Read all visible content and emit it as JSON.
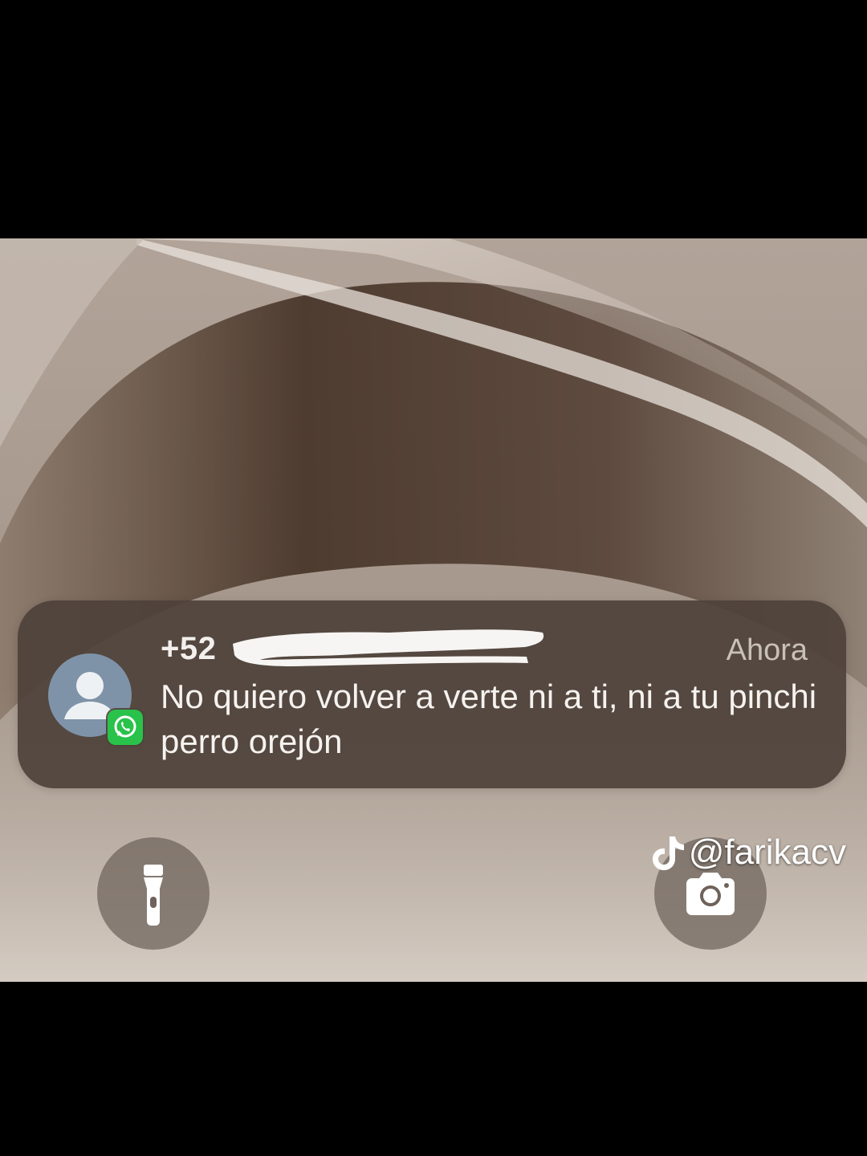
{
  "notification": {
    "sender": "+52",
    "time": "Ahora",
    "message": "No quiero volver a verte ni a ti, ni a tu pinchi perro orejón",
    "app_icon": "whatsapp-icon",
    "avatar_icon": "default-person-icon"
  },
  "lockscreen": {
    "left_shortcut_icon": "flashlight-icon",
    "right_shortcut_icon": "camera-icon"
  },
  "watermark": {
    "text": "@farikacv",
    "icon": "tiktok-icon"
  },
  "colors": {
    "notification_bg": "#4e423a",
    "whatsapp_green": "#29c24a",
    "avatar_bg": "#7f93a8",
    "wallpaper_dark": "#3a2b22",
    "wallpaper_light": "#c9bfb6"
  }
}
